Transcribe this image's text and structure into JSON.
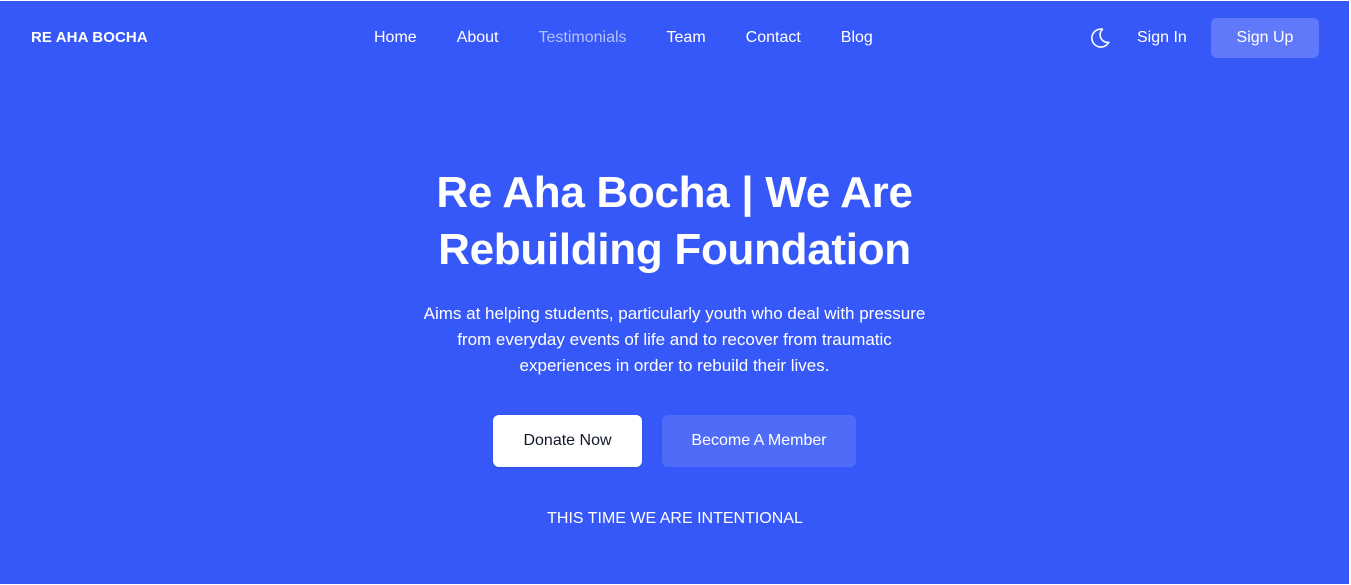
{
  "header": {
    "logo": "RE AHA BOCHA",
    "nav": [
      {
        "label": "Home",
        "active": false
      },
      {
        "label": "About",
        "active": false
      },
      {
        "label": "Testimonials",
        "active": true
      },
      {
        "label": "Team",
        "active": false
      },
      {
        "label": "Contact",
        "active": false
      },
      {
        "label": "Blog",
        "active": false
      }
    ],
    "theme_icon": "moon-icon",
    "sign_in_label": "Sign In",
    "sign_up_label": "Sign Up"
  },
  "hero": {
    "title_line1": "Re Aha Bocha | We Are",
    "title_line2": "Rebuilding Foundation",
    "description_line1": "Aims at helping students, particularly youth who deal with pressure",
    "description_line2": "from everyday events of life and to recover from traumatic",
    "description_line3": "experiences in order to rebuild their lives.",
    "donate_label": "Donate Now",
    "member_label": "Become A Member",
    "tagline": "THIS TIME WE ARE INTENTIONAL"
  },
  "colors": {
    "background": "#3758f9",
    "text": "#ffffff",
    "donate_text": "#111928"
  }
}
